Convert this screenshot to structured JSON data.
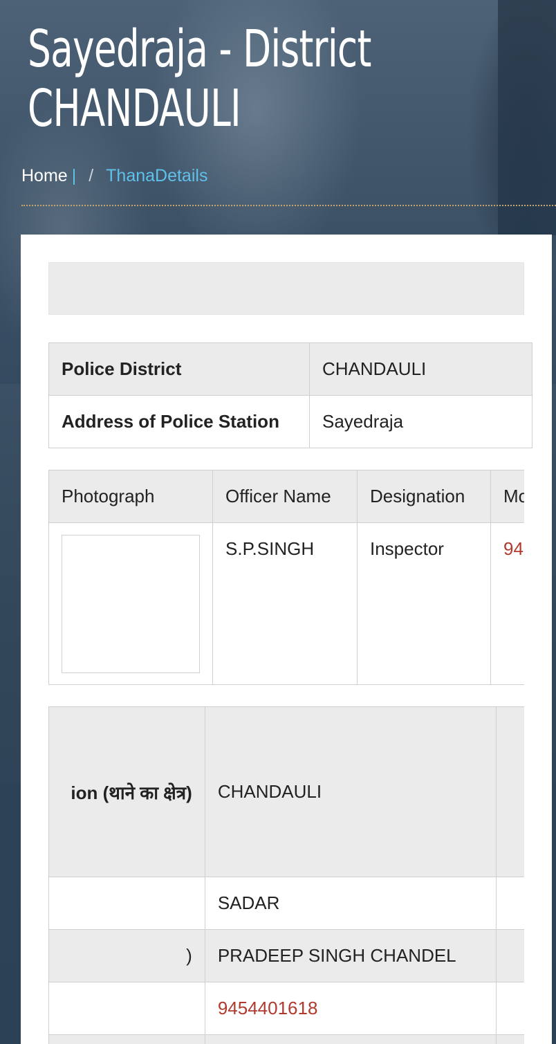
{
  "header": {
    "title_line1": "Sayedraja - District",
    "title_line2": "CHANDAULI"
  },
  "breadcrumb": {
    "home": "Home",
    "bar": "|",
    "slash": "/",
    "current": "ThanaDetails"
  },
  "station_info": [
    {
      "label": "Police District",
      "value": "CHANDAULI"
    },
    {
      "label": "Address of Police Station",
      "value": "Sayedraja"
    }
  ],
  "officer_table": {
    "headers": [
      "Photograph",
      "Officer Name",
      "Designation",
      "Mo"
    ],
    "row": {
      "name": "S.P.SINGH",
      "designation": "Inspector",
      "mobile_partial": "94"
    }
  },
  "circle_table": {
    "rows": [
      {
        "label": "ion (थाने का क्षेत्र)",
        "value": "CHANDAULI"
      },
      {
        "label": "",
        "value": "SADAR"
      },
      {
        "label": ")",
        "value": "PRADEEP SINGH CHANDEL"
      },
      {
        "label": "",
        "value": "9454401618"
      }
    ]
  },
  "colors": {
    "accent_link": "#5fc1ea",
    "phone_red": "#b03a2e",
    "divider_gold": "#c9a46a"
  }
}
